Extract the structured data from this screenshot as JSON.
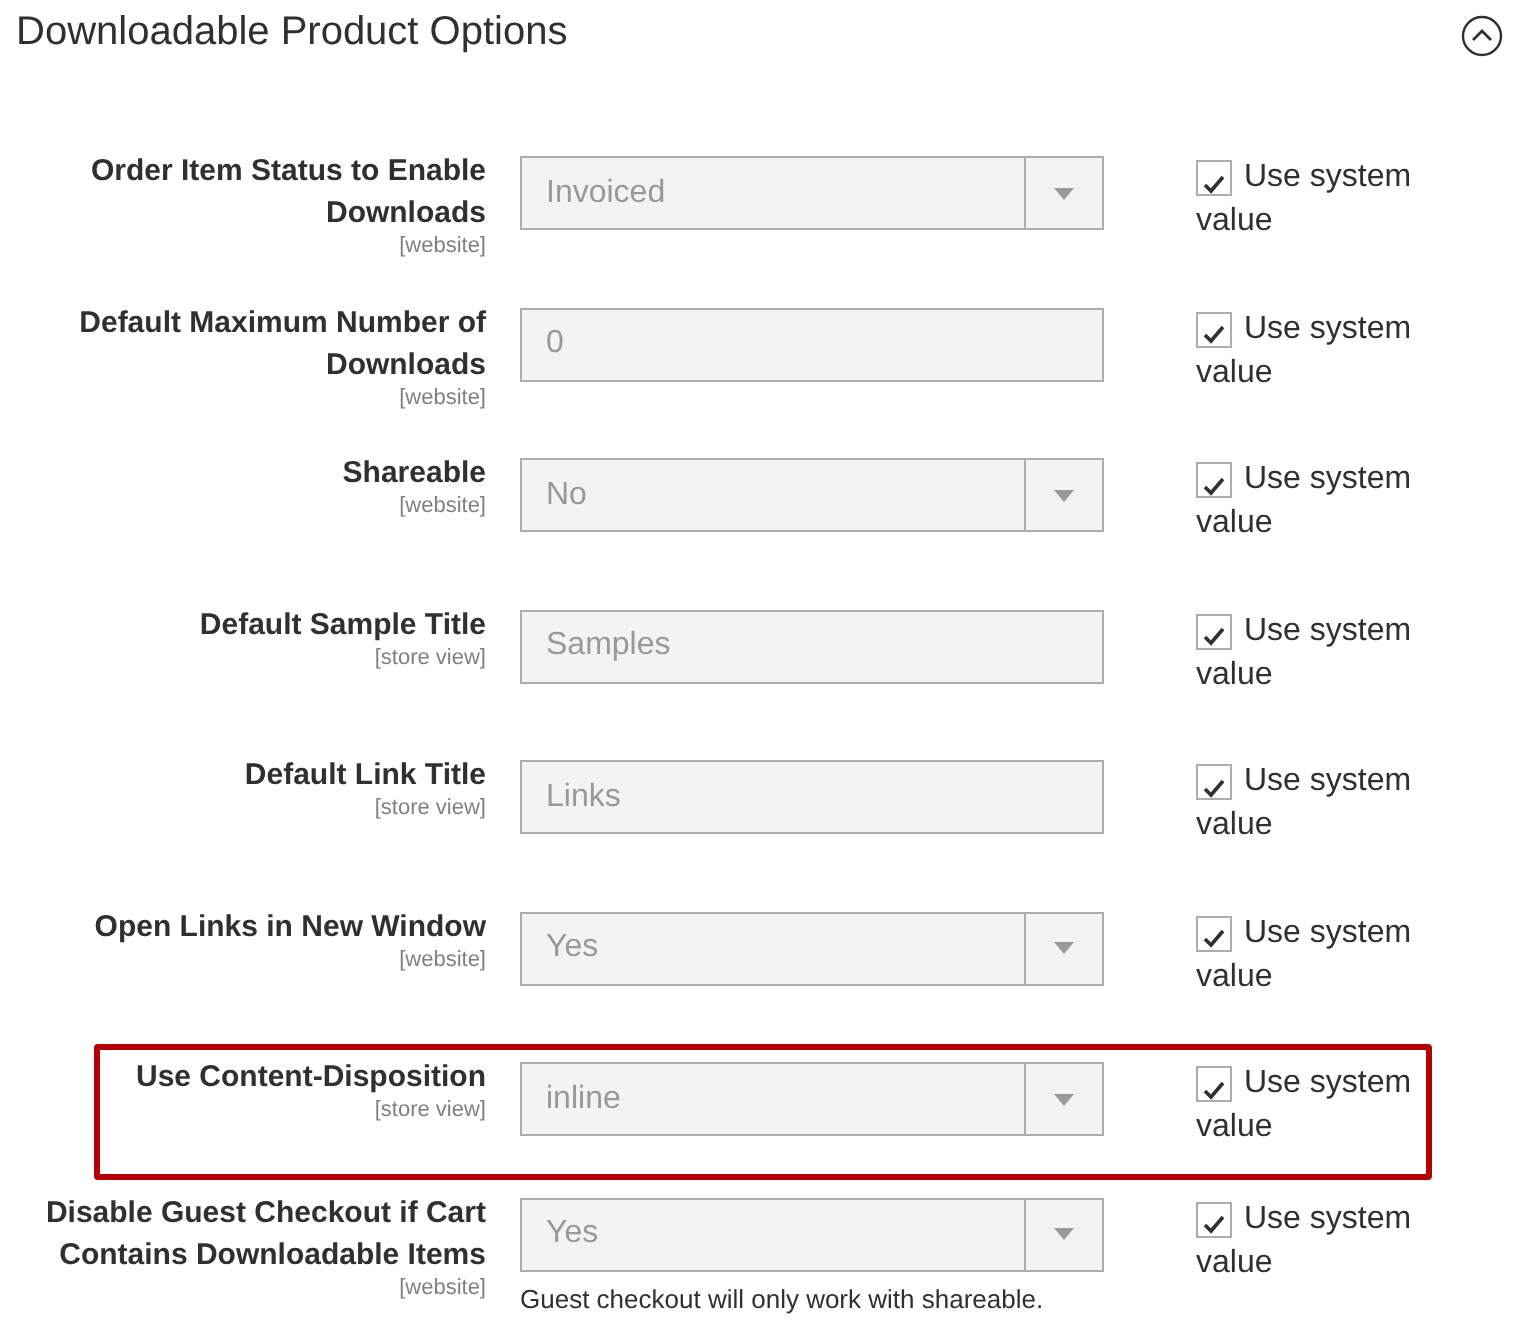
{
  "section": {
    "title": "Downloadable Product Options",
    "expanded": true
  },
  "rows": [
    {
      "label": "Order Item Status to Enable Downloads",
      "scope": "[website]",
      "kind": "select",
      "value": "Invoiced",
      "disabled": true,
      "use_system_value": {
        "label": "Use system value",
        "checked": true
      },
      "highlighted": false
    },
    {
      "label": "Default Maximum Number of Downloads",
      "scope": "[website]",
      "kind": "text",
      "value": "0",
      "disabled": true,
      "use_system_value": {
        "label": "Use system value",
        "checked": true
      },
      "highlighted": false
    },
    {
      "label": "Shareable",
      "scope": "[website]",
      "kind": "select",
      "value": "No",
      "disabled": true,
      "use_system_value": {
        "label": "Use system value",
        "checked": true
      },
      "highlighted": false
    },
    {
      "label": "Default Sample Title",
      "scope": "[store view]",
      "kind": "text",
      "value": "Samples",
      "disabled": true,
      "use_system_value": {
        "label": "Use system value",
        "checked": true
      },
      "highlighted": false
    },
    {
      "label": "Default Link Title",
      "scope": "[store view]",
      "kind": "text",
      "value": "Links",
      "disabled": true,
      "use_system_value": {
        "label": "Use system value",
        "checked": true
      },
      "highlighted": false
    },
    {
      "label": "Open Links in New Window",
      "scope": "[website]",
      "kind": "select",
      "value": "Yes",
      "disabled": true,
      "use_system_value": {
        "label": "Use system value",
        "checked": true
      },
      "highlighted": false
    },
    {
      "label": "Use Content-Disposition",
      "scope": "[store view]",
      "kind": "select",
      "value": "inline",
      "disabled": true,
      "use_system_value": {
        "label": "Use system value",
        "checked": true
      },
      "highlighted": true
    },
    {
      "label": "Disable Guest Checkout if Cart Contains Downloadable Items",
      "scope": "[website]",
      "kind": "select",
      "value": "Yes",
      "disabled": true,
      "use_system_value": {
        "label": "Use system value",
        "checked": true
      },
      "highlighted": false,
      "note": "Guest checkout will only work with shareable."
    }
  ]
}
